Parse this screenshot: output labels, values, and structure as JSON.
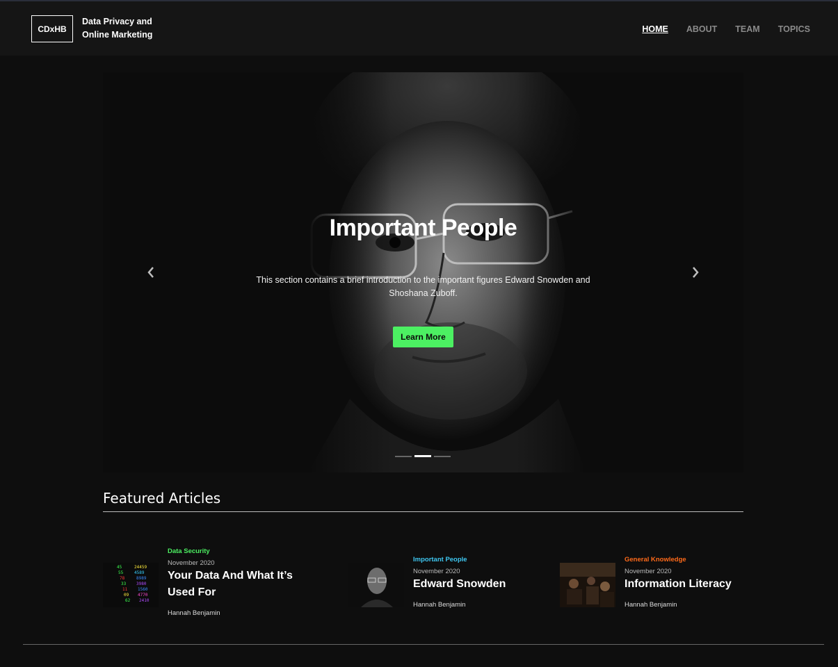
{
  "header": {
    "logo": "CDxHB",
    "site_title_line1": "Data Privacy and",
    "site_title_line2": "Online Marketing",
    "nav": [
      {
        "label": "HOME",
        "active": true
      },
      {
        "label": "ABOUT",
        "active": false
      },
      {
        "label": "TEAM",
        "active": false
      },
      {
        "label": "TOPICS",
        "active": false
      }
    ]
  },
  "hero": {
    "title": "Important People",
    "description": "This section contains a brief introduction to the important figures Edward Snowden and Shoshana Zuboff.",
    "button_label": "Learn More",
    "prev_icon": "chevron-left-icon",
    "next_icon": "chevron-right-icon",
    "slide_count": 3,
    "active_slide": 2
  },
  "featured": {
    "heading": "Featured Articles",
    "articles": [
      {
        "category": "Data Security",
        "category_color": "#4cf062",
        "date": "November 2020",
        "title_line1": "Your Data And What It’s",
        "title_line2": "Used For",
        "author": "Hannah Benjamin"
      },
      {
        "category": "Important People",
        "category_color": "#3fc8f2",
        "date": "November 2020",
        "title_line1": "Edward Snowden",
        "author": "Hannah Benjamin"
      },
      {
        "category": "General Knowledge",
        "category_color": "#ff6a1a",
        "date": "November 2020",
        "title_line1": "Information Literacy",
        "author": "Hannah Benjamin"
      }
    ]
  },
  "colors": {
    "accent_green": "#4cf062",
    "background": "#0e0e0e",
    "header_bg": "#151515"
  }
}
